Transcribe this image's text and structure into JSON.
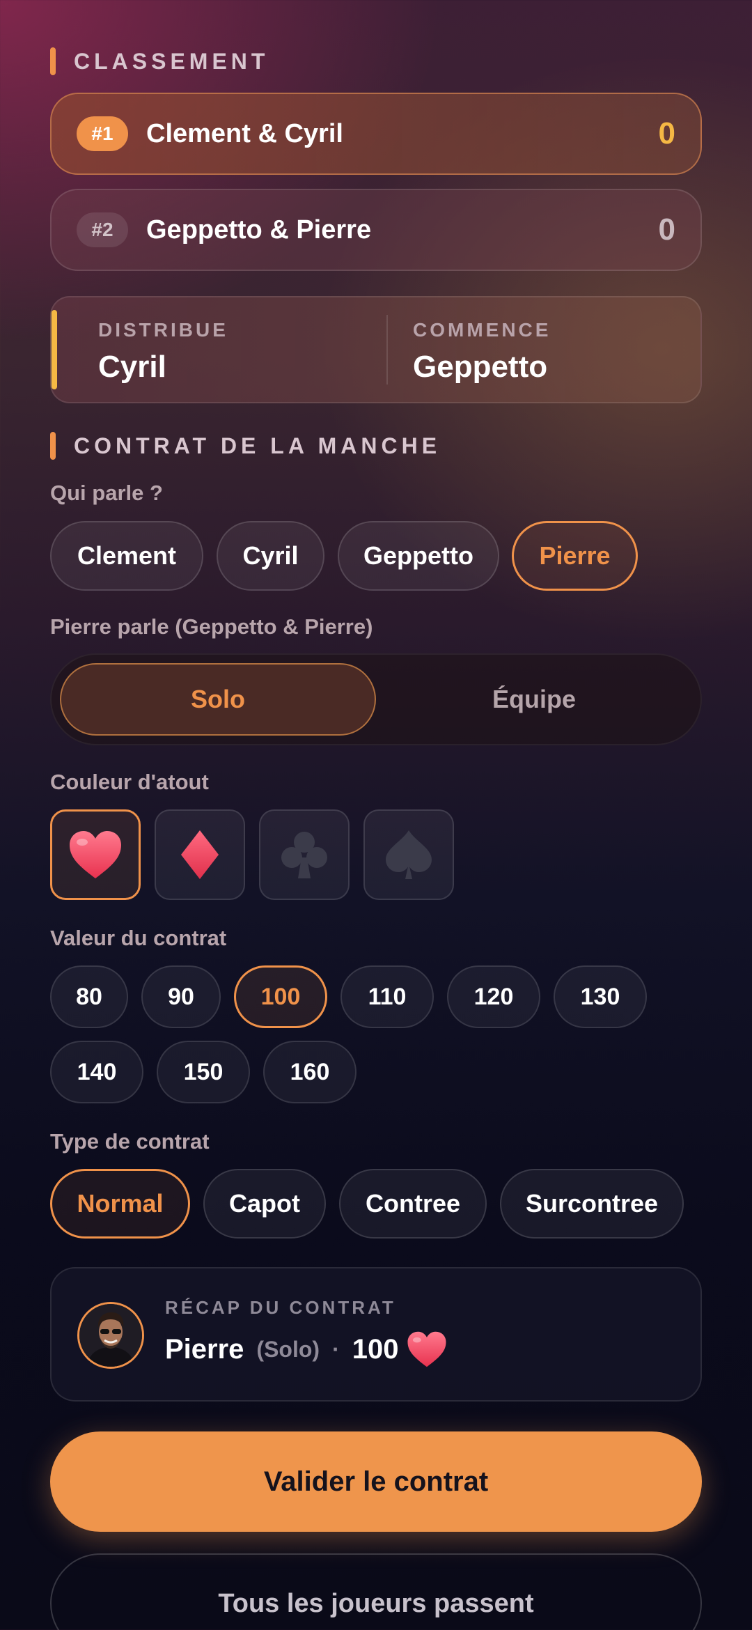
{
  "ranking": {
    "title": "CLASSEMENT",
    "rows": [
      {
        "rank": "#1",
        "team": "Clement & Cyril",
        "score": "0"
      },
      {
        "rank": "#2",
        "team": "Geppetto & Pierre",
        "score": "0"
      }
    ]
  },
  "round_info": {
    "dealer_label": "DISTRIBUE",
    "dealer": "Cyril",
    "starter_label": "COMMENCE",
    "starter": "Geppetto"
  },
  "contract": {
    "title": "CONTRAT DE LA MANCHE",
    "speaker_question": "Qui parle ?",
    "players": [
      "Clement",
      "Cyril",
      "Geppetto",
      "Pierre"
    ],
    "selected_player": "Pierre",
    "speaker_caption": "Pierre parle (Geppetto & Pierre)",
    "mode_options": [
      "Solo",
      "Équipe"
    ],
    "selected_mode": "Solo",
    "trump_label": "Couleur d'atout",
    "suits": [
      "heart-icon",
      "diamond-icon",
      "club-icon",
      "spade-icon"
    ],
    "selected_suit": "heart-icon",
    "value_label": "Valeur du contrat",
    "values": [
      "80",
      "90",
      "100",
      "110",
      "120",
      "130",
      "140",
      "150",
      "160"
    ],
    "selected_value": "100",
    "type_label": "Type de contrat",
    "types": [
      "Normal",
      "Capot",
      "Contree",
      "Surcontree"
    ],
    "selected_type": "Normal"
  },
  "recap": {
    "label": "RÉCAP DU CONTRAT",
    "player": "Pierre",
    "mode": "(Solo)",
    "separator": "·",
    "value": "100",
    "suit_icon": "heart-icon"
  },
  "actions": {
    "validate_label": "Valider le contrat",
    "pass_label": "Tous les joueurs passent"
  },
  "colors": {
    "accent": "#f0924a",
    "gold": "#f5b844",
    "heart": "#ff4d6d",
    "diamond": "#ff4d6d",
    "club": "#3a3a48",
    "spade": "#3a3a48"
  }
}
